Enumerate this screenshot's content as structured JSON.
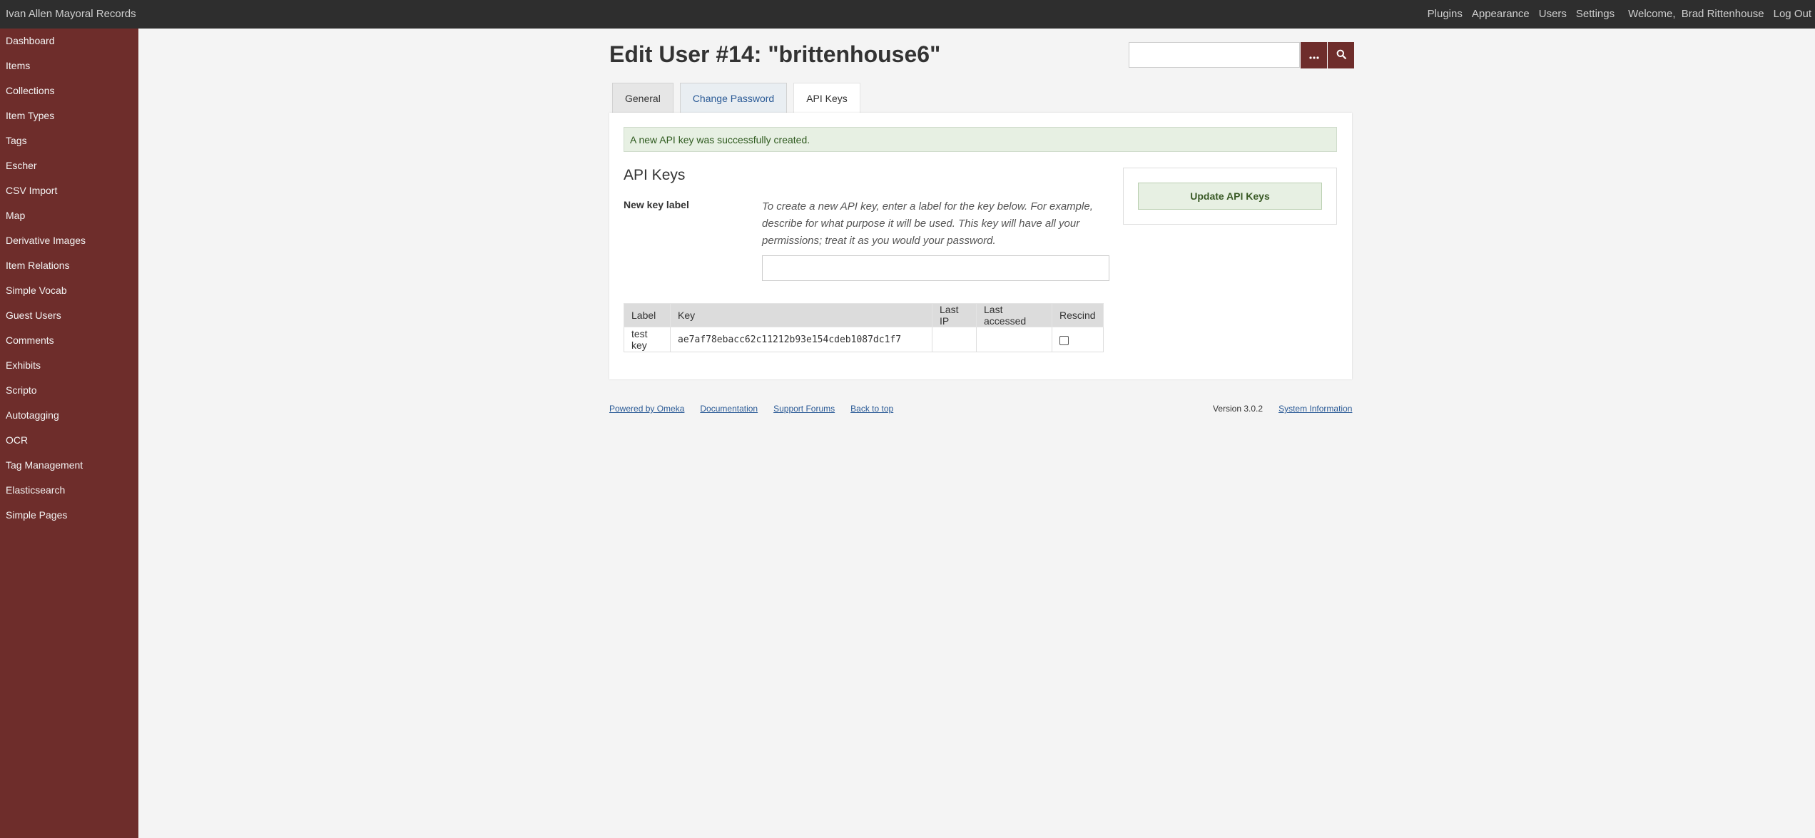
{
  "header": {
    "site_title": "Ivan Allen Mayoral Records",
    "nav": [
      "Plugins",
      "Appearance",
      "Users",
      "Settings"
    ],
    "welcome_prefix": "Welcome,",
    "user_name": "Brad Rittenhouse",
    "logout": "Log Out"
  },
  "sidebar": {
    "items": [
      {
        "label": "Dashboard"
      },
      {
        "label": "Items"
      },
      {
        "label": "Collections"
      },
      {
        "label": "Item Types"
      },
      {
        "label": "Tags"
      },
      {
        "label": "Escher"
      },
      {
        "label": "CSV Import"
      },
      {
        "label": "Map"
      },
      {
        "label": "Derivative Images"
      },
      {
        "label": "Item Relations"
      },
      {
        "label": "Simple Vocab"
      },
      {
        "label": "Guest Users"
      },
      {
        "label": "Comments"
      },
      {
        "label": "Exhibits"
      },
      {
        "label": "Scripto"
      },
      {
        "label": "Autotagging"
      },
      {
        "label": "OCR"
      },
      {
        "label": "Tag Management"
      },
      {
        "label": "Elasticsearch"
      },
      {
        "label": "Simple Pages"
      }
    ]
  },
  "main": {
    "page_title": "Edit User #14: \"brittenhouse6\"",
    "search": {
      "placeholder": "",
      "options_icon": "ellipsis-icon",
      "submit_icon": "search-icon"
    },
    "tabs": [
      {
        "label": "General"
      },
      {
        "label": "Change Password"
      },
      {
        "label": "API Keys"
      }
    ],
    "flash_message": "A new API key was successfully created.",
    "section_heading": "API Keys",
    "new_key_label": "New key label",
    "new_key_hint": "To create a new API key, enter a label for the key below. For example, describe for what purpose it will be used. This key will have all your permissions; treat it as you would your password.",
    "new_key_value": "",
    "table": {
      "headers": [
        "Label",
        "Key",
        "Last IP",
        "Last accessed",
        "Rescind"
      ],
      "rows": [
        {
          "label": "test key",
          "key": "ae7af78ebacc62c11212b93e154cdeb1087dc1f7",
          "last_ip": "",
          "last_accessed": "",
          "rescind": false
        }
      ]
    },
    "update_button": "Update API Keys"
  },
  "footer": {
    "links": [
      "Powered by Omeka",
      "Documentation",
      "Support Forums",
      "Back to top"
    ],
    "version": "Version 3.0.2",
    "system_info": "System Information"
  },
  "colors": {
    "sidebar_bg": "#6e2d2b",
    "topbar_bg": "#2e2e2e",
    "accent": "#6e2d2b",
    "success_bg": "#e7f0e3"
  }
}
